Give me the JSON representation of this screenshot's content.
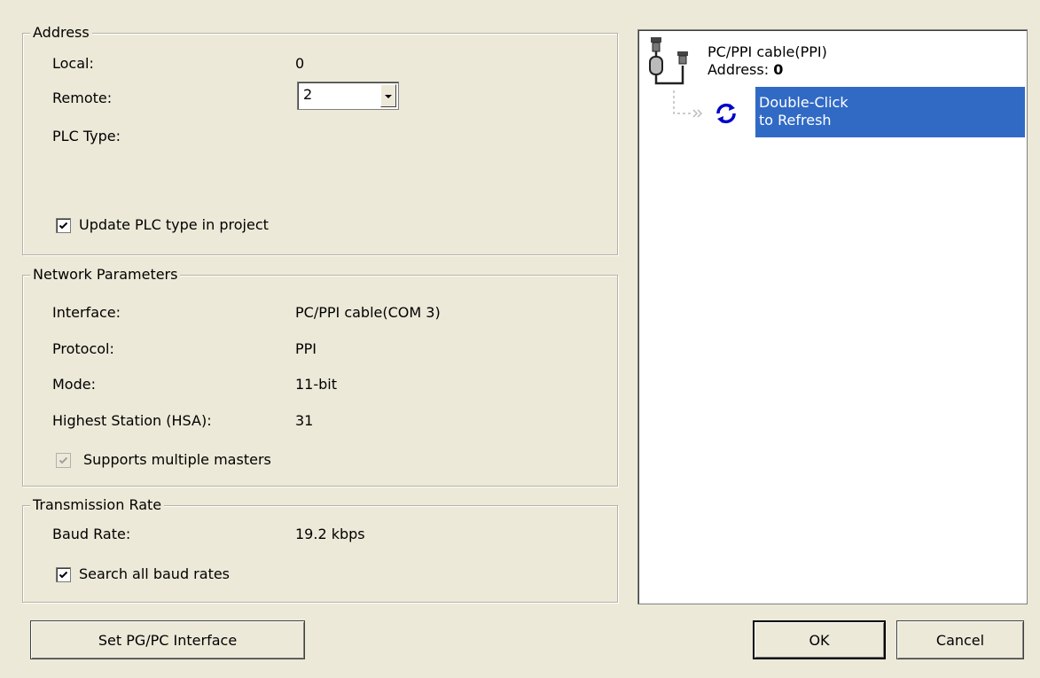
{
  "address": {
    "title": "Address",
    "local_label": "Local:",
    "local_value": "0",
    "remote_label": "Remote:",
    "remote_value": "2",
    "plc_type_label": "PLC Type:",
    "plc_type_value": "",
    "update_label": "Update PLC type in project",
    "update_checked": true
  },
  "network": {
    "title": "Network Parameters",
    "interface_label": "Interface:",
    "interface_value": "PC/PPI cable(COM 3)",
    "protocol_label": "Protocol:",
    "protocol_value": "PPI",
    "mode_label": "Mode:",
    "mode_value": "11-bit",
    "hsa_label": "Highest Station (HSA):",
    "hsa_value": "31",
    "multi_label": "Supports multiple masters",
    "multi_checked": true,
    "multi_enabled": false
  },
  "transmission": {
    "title": "Transmission Rate",
    "baud_label": "Baud Rate:",
    "baud_value": "19.2 kbps",
    "search_label": "Search all baud rates",
    "search_checked": true
  },
  "tree": {
    "root_label": "PC/PPI cable(PPI)",
    "address_label": "Address:",
    "address_value": "0",
    "child_line1": "Double-Click",
    "child_line2": "to Refresh"
  },
  "buttons": {
    "set_interface": "Set PG/PC Interface",
    "ok": "OK",
    "cancel": "Cancel"
  },
  "colors": {
    "dialog_bg": "#ece9d8",
    "selection_bg": "#316ac5",
    "refresh_icon": "#0000cc"
  }
}
